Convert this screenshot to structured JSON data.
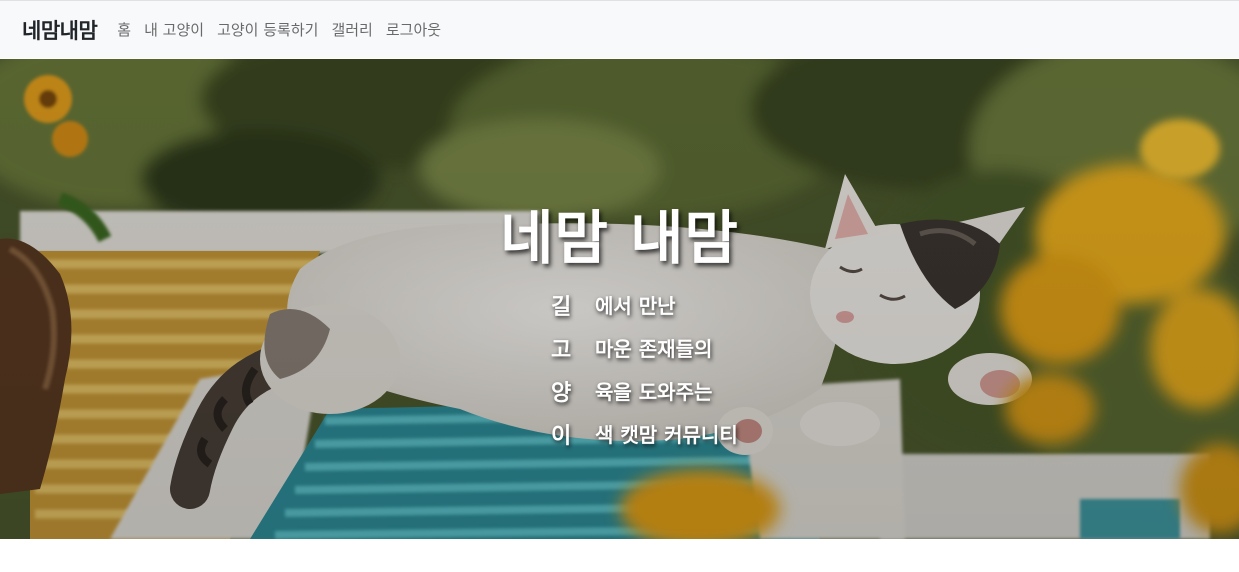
{
  "navbar": {
    "brand": "네맘내맘",
    "links": [
      "홈",
      "내 고양이",
      "고양이 등록하기",
      "갤러리",
      "로그아웃"
    ]
  },
  "hero": {
    "title": "네맘 내맘",
    "acrostic": [
      {
        "letter": "길",
        "text": "에서 만난"
      },
      {
        "letter": "고",
        "text": "마운 존재들의"
      },
      {
        "letter": "양",
        "text": "육을 도와주는"
      },
      {
        "letter": "이",
        "text": "색 캣맘 커뮤니티"
      }
    ],
    "image": "cat-sleeping-photo",
    "colors": {
      "foliage": "#4a5a2c",
      "cat": "#f1eee8",
      "bench_blue": "#3fa9b5",
      "bench_yellow": "#d8b04a",
      "flower": "#f0b020"
    }
  }
}
